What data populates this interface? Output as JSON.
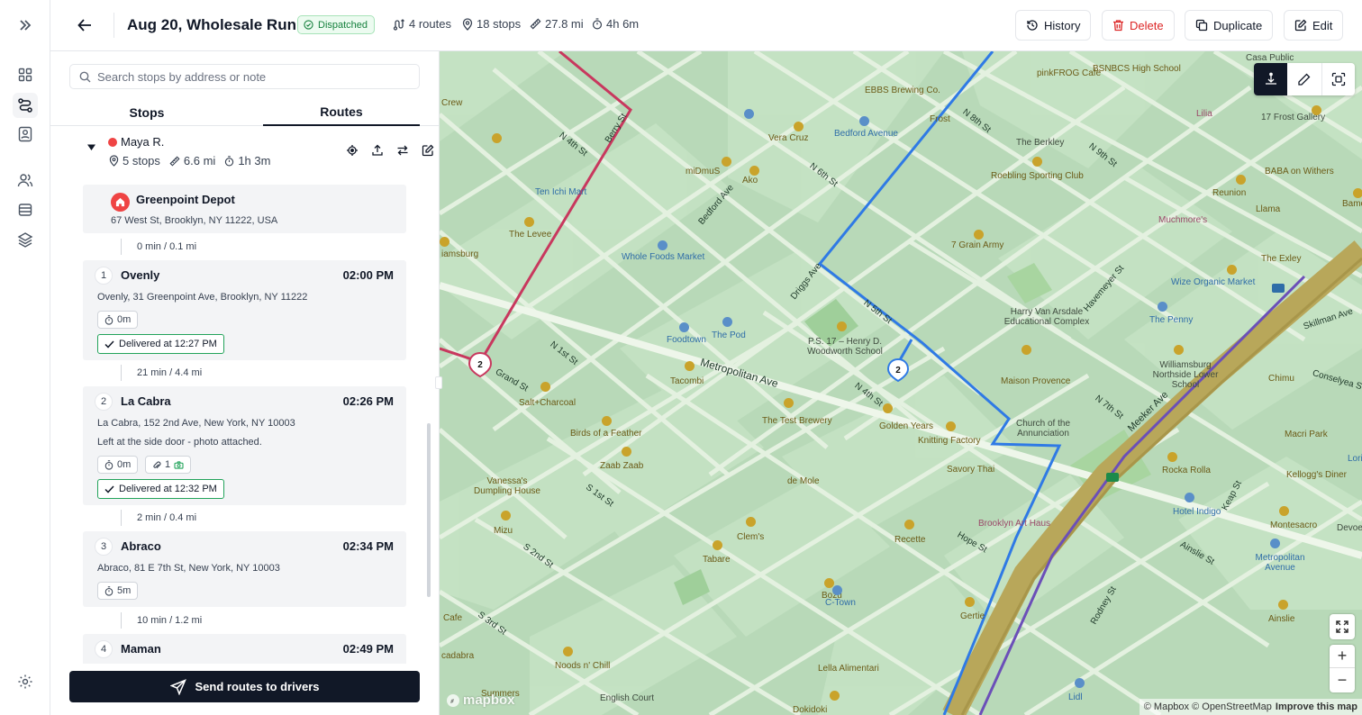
{
  "nav": {
    "icons": [
      "expand-icon",
      "dashboard-icon",
      "routes-icon",
      "contacts-icon",
      "team-icon",
      "inventory-icon",
      "layers-icon",
      "settings-icon"
    ]
  },
  "header": {
    "title": "Aug 20, Wholesale Run",
    "status": "Dispatched",
    "routes": "4 routes",
    "stops": "18 stops",
    "distance": "27.8 mi",
    "duration": "4h 6m",
    "buttons": {
      "history": "History",
      "delete": "Delete",
      "duplicate": "Duplicate",
      "edit": "Edit"
    }
  },
  "search": {
    "placeholder": "Search stops by address or note"
  },
  "tabs": {
    "stops": "Stops",
    "routes": "Routes",
    "active": "Routes"
  },
  "route": {
    "driver": "Maya R.",
    "color": "#ef4444",
    "stops": "5 stops",
    "distance": "6.6 mi",
    "duration": "1h 3m"
  },
  "depot": {
    "name": "Greenpoint Depot",
    "address": "67 West St, Brooklyn, NY 11222, USA"
  },
  "legs": [
    "0 min / 0.1 mi",
    "21 min / 4.4 mi",
    "2 min / 0.4 mi",
    "10 min / 1.2 mi"
  ],
  "stops": [
    {
      "num": "1",
      "name": "Ovenly",
      "time": "02:00 PM",
      "address": "Ovenly, 31 Greenpoint Ave, Brooklyn, NY 11222",
      "service": "0m",
      "delivered": "Delivered at 12:27 PM"
    },
    {
      "num": "2",
      "name": "La Cabra",
      "time": "02:26 PM",
      "address": "La Cabra, 152 2nd Ave, New York, NY 10003",
      "note": "Left at the side door - photo attached.",
      "service": "0m",
      "attachments": "1",
      "delivered": "Delivered at 12:32 PM"
    },
    {
      "num": "3",
      "name": "Abraco",
      "time": "02:34 PM",
      "address": "Abraco, 81 E 7th St, New York, NY 10003",
      "service": "5m"
    },
    {
      "num": "4",
      "name": "Maman",
      "time": "02:49 PM"
    }
  ],
  "send_button": "Send routes to drivers",
  "map": {
    "attribution": "© Mapbox © OpenStreetMap",
    "improve": "Improve this map",
    "logo": "mapbox",
    "route_colors": {
      "red": "#c8385e",
      "blue": "#2f7ae5",
      "purple": "#6b4fb8"
    },
    "markers": [
      {
        "label": "2",
        "color": "#c8385e"
      },
      {
        "label": "2",
        "color": "#2f7ae5"
      }
    ],
    "streets": [
      "N 4th St",
      "Berry St",
      "Bedford Ave",
      "N 6th St",
      "N 8th St",
      "N 9th St",
      "Driggs Ave",
      "N 5th St",
      "N 1st St",
      "Metropolitan Ave",
      "N 4th St",
      "Grand St",
      "S 1st St",
      "S 2nd St",
      "S 3rd St",
      "Hope St",
      "Havemeyer St",
      "N 7th St",
      "Meeker Ave",
      "Conselyea St",
      "Keap St",
      "Ainslie St",
      "Rodney St",
      "Skillman Ave"
    ],
    "places": [
      "BSNBCS High School",
      "Casa Public",
      "EBBS Brewing Co.",
      "pinkFROG Cafe",
      "Lilia",
      "17 Frost Gallery",
      "Frost",
      "Bedford Avenue",
      "Vera Cruz",
      "The Berkley",
      "Roebling Sporting Club",
      "BABA on Withers",
      "Reunion",
      "Bamonte's",
      "Llama",
      "miDmuS",
      "Ako",
      "Ten Ichi Mart",
      "The Levee",
      "Whole Foods Market",
      "7 Grain Army",
      "Muchmore's",
      "The Exley",
      "Wize Organic Market",
      "Harry Van Arsdale Educational Complex",
      "The Penny",
      "Williamsburg Northside Lower School",
      "Chimu",
      "P.S. 17 – Henry D. Woodworth School",
      "Foodtown",
      "The Pod",
      "Tacombi",
      "Maison Provence",
      "Church of the Annunciation",
      "Macri Park",
      "Lorimer",
      "The Test Brewery",
      "Golden Years",
      "Knitting Factory",
      "Salt+Charcoal",
      "Birds of a Feather",
      "Zaab Zaab",
      "Savory Thai",
      "Rocka Rolla",
      "Kellogg's Diner",
      "Vanessa's Dumpling House",
      "de Mole",
      "Hotel Indigo",
      "Mizu",
      "Brooklyn Art Haus",
      "Clem's",
      "Montesacro",
      "Tabare",
      "Recette",
      "Metropolitan Avenue",
      "Bozu",
      "C-Town",
      "Gertie",
      "Ainslie",
      "Noods n' Chill",
      "Lella Alimentari",
      "English Court",
      "Lidl",
      "Dokidoki",
      "Cafe",
      "cadabra",
      "Summers",
      "Devoe",
      "Crew",
      "iamsburg"
    ]
  }
}
